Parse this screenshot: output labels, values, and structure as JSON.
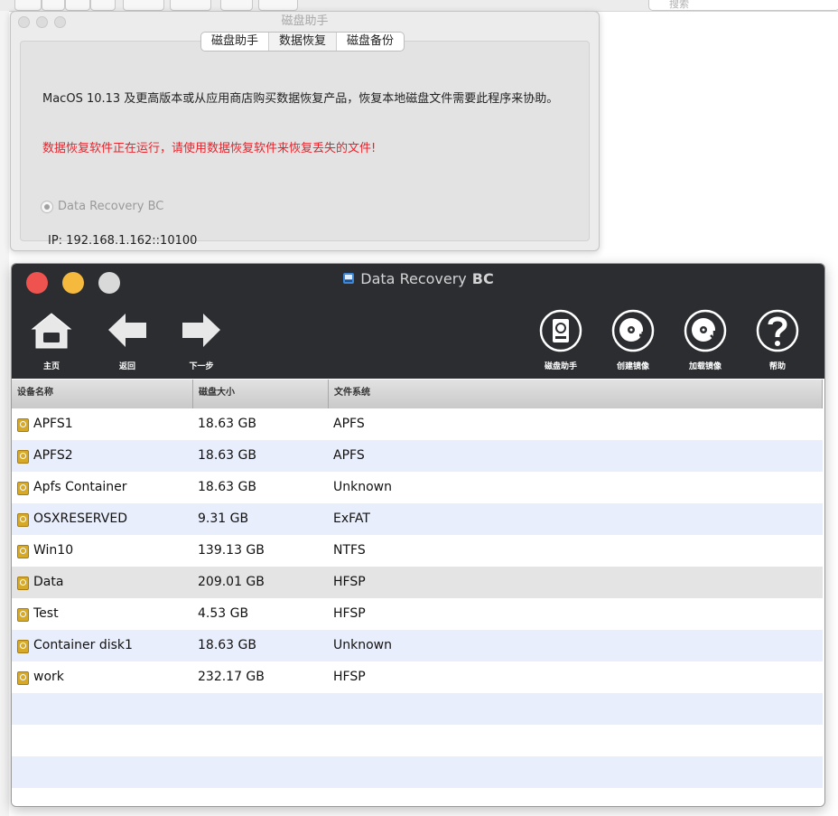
{
  "background": {
    "search_placeholder": "搜索"
  },
  "assistant": {
    "window_title": "磁盘助手",
    "tabs": [
      "磁盘助手",
      "数据恢复",
      "磁盘备份"
    ],
    "description": "MacOS 10.13 及更高版本或从应用商店购买数据恢复产品，恢复本地磁盘文件需要此程序来协助。",
    "warning": "数据恢复软件正在运行，请使用数据恢复软件来恢复丢失的文件!",
    "radio_label": "Data Recovery BC",
    "ip": "IP: 192.168.1.162::10100"
  },
  "app": {
    "title": "Data Recovery",
    "title_suffix": "BC",
    "toolbar": {
      "home": "主页",
      "back": "返回",
      "next": "下一步",
      "disk_assistant": "磁盘助手",
      "create_image": "创建镜像",
      "load_image": "加载镜像",
      "help": "帮助"
    },
    "columns": [
      "设备名称",
      "磁盘大小",
      "文件系统"
    ],
    "rows": [
      {
        "name": "APFS1",
        "size": "18.63 GB",
        "fs": "APFS"
      },
      {
        "name": "APFS2",
        "size": "18.63 GB",
        "fs": "APFS"
      },
      {
        "name": "Apfs Container",
        "size": "18.63 GB",
        "fs": "Unknown"
      },
      {
        "name": "OSXRESERVED",
        "size": "9.31 GB",
        "fs": "ExFAT"
      },
      {
        "name": "Win10",
        "size": "139.13 GB",
        "fs": "NTFS"
      },
      {
        "name": " Data",
        "size": "209.01 GB",
        "fs": "HFSP"
      },
      {
        "name": "Test",
        "size": "4.53 GB",
        "fs": "HFSP"
      },
      {
        "name": "Container disk1",
        "size": "18.63 GB",
        "fs": "Unknown"
      },
      {
        "name": "work",
        "size": "232.17 GB",
        "fs": "HFSP"
      }
    ],
    "selected_row": 5,
    "empty_rows": 4,
    "colors": {
      "close": "#ef5350",
      "minimize": "#f4b93d",
      "zoom": "#d9d9d9",
      "titlebar": "#2b2d31"
    }
  }
}
